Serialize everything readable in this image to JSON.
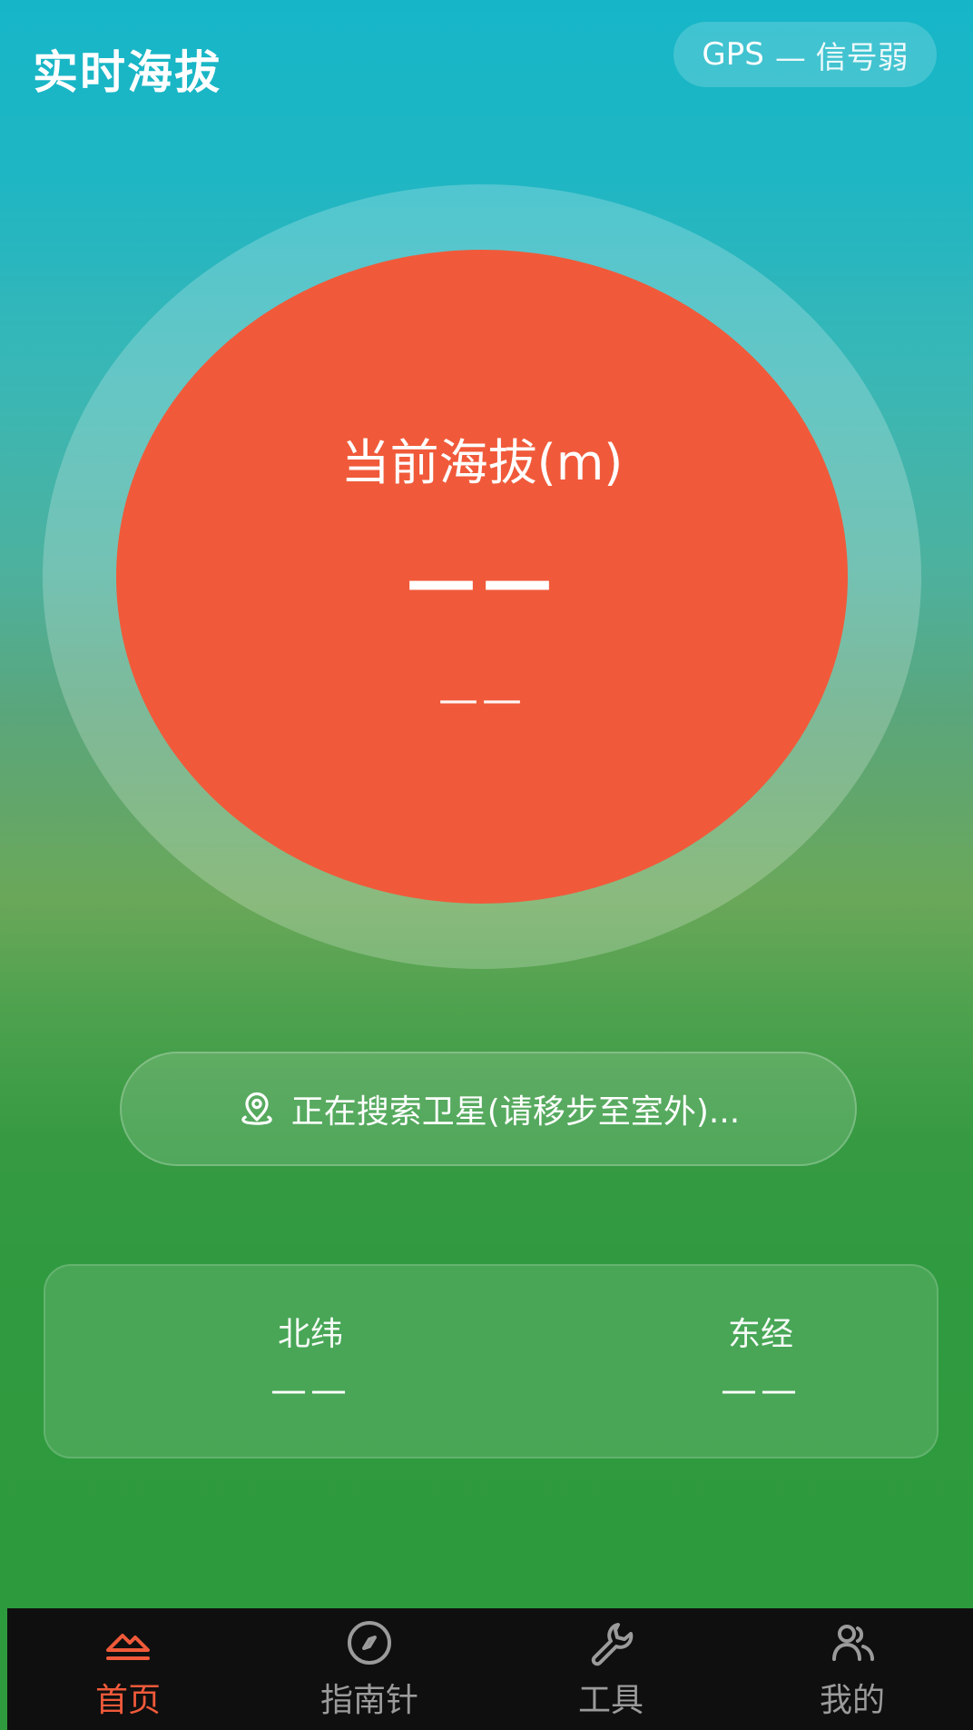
{
  "header": {
    "title": "实时海拔",
    "gps_label": "GPS",
    "gps_value": "— 信号弱"
  },
  "altitude": {
    "label": "当前海拔(m)",
    "value": "——",
    "sub_value": "——"
  },
  "status": {
    "text": "正在搜索卫星(请移步至室外)...",
    "icon": "location-pin-icon"
  },
  "coordinates": {
    "latitude_label": "北纬",
    "latitude_value": "——",
    "longitude_label": "东经",
    "longitude_value": "——"
  },
  "nav": {
    "items": [
      {
        "label": "首页",
        "icon": "mountain-icon",
        "active": true
      },
      {
        "label": "指南针",
        "icon": "compass-icon",
        "active": false
      },
      {
        "label": "工具",
        "icon": "wrench-icon",
        "active": false
      },
      {
        "label": "我的",
        "icon": "users-icon",
        "active": false
      }
    ]
  },
  "colors": {
    "accent": "#f05a3a",
    "nav_bg": "#0f0f0f",
    "nav_inactive": "#9b9b9b"
  }
}
